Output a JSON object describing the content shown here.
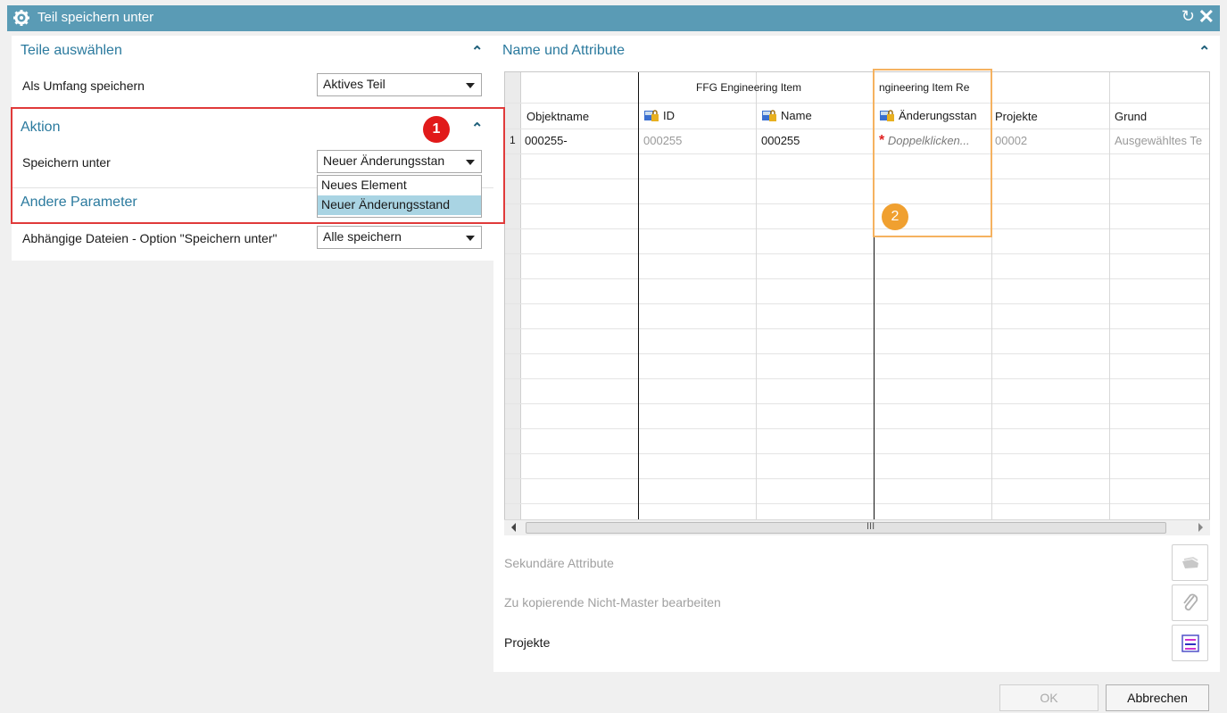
{
  "window": {
    "title": "Teil speichern unter"
  },
  "left": {
    "teile_auswaehlen": {
      "heading": "Teile auswählen",
      "umfang_label": "Als Umfang speichern",
      "umfang_value": "Aktives Teil"
    },
    "aktion": {
      "heading": "Aktion",
      "speichern_label": "Speichern unter",
      "speichern_value": "Neuer Änderungsstan",
      "options": [
        "Neues Element",
        "Neuer Änderungsstand"
      ],
      "selected_option": "Neuer Änderungsstand"
    },
    "andere": {
      "heading": "Andere Parameter",
      "abh_label": "Abhängige Dateien - Option \"Speichern unter\"",
      "abh_value": "Alle speichern"
    }
  },
  "annotations": {
    "badge1": "1",
    "badge2": "2"
  },
  "right": {
    "heading": "Name und Attribute",
    "table": {
      "group_headers": [
        "FFG Engineering Item",
        "ngineering Item Re"
      ],
      "columns": [
        "Objektname",
        "ID",
        "Name",
        "Änderungsstan",
        "Projekte",
        "Grund"
      ],
      "rows": [
        {
          "num": "1",
          "objektname": "000255-",
          "id": "000255",
          "name": "000255",
          "aenderungsstand": "Doppelklicken...",
          "projekte": "00002",
          "grund": "Ausgewähltes Te"
        }
      ]
    },
    "sekundaere_attribute": "Sekundäre Attribute",
    "nicht_master": "Zu kopierende Nicht-Master bearbeiten",
    "projekte": "Projekte"
  },
  "buttons": {
    "ok": "OK",
    "cancel": "Abbrechen"
  },
  "colors": {
    "titlebar": "#5a9bb5",
    "heading": "#2b7a9e",
    "highlight_red": "#e03a3a",
    "highlight_orange": "#f5b260",
    "selected_option": "#a9d4e3"
  }
}
